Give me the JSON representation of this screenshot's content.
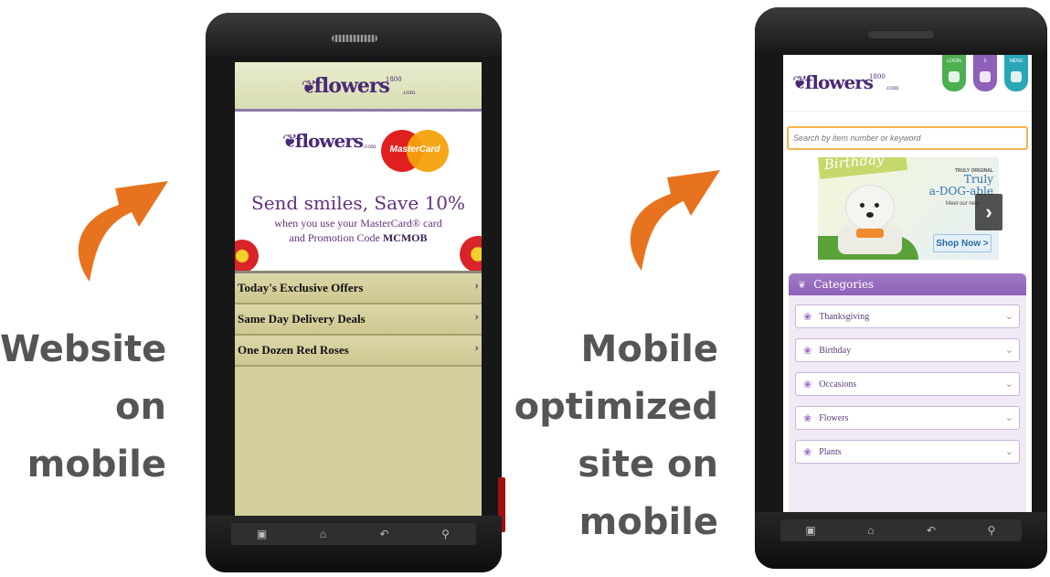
{
  "captions": {
    "left": [
      "Website",
      "on",
      "mobile"
    ],
    "right": [
      "Mobile",
      "optimized",
      "site on",
      "mobile"
    ]
  },
  "colors": {
    "arrow": "#e8731f",
    "caption": "#555555",
    "purple": "#8e60b8",
    "mastercard_red": "#e0201f",
    "mastercard_yellow": "#f5a20b"
  },
  "icons": {
    "arrows": "curved-up-right-arrow-icon",
    "phone_nav": [
      "menu-icon",
      "home-icon",
      "back-icon",
      "search-icon"
    ]
  },
  "left_phone": {
    "header_logo": {
      "number": "1800",
      "brand": "flowers",
      "suffix": ".com"
    },
    "banner": {
      "logo_brand": "flowers",
      "logo_suffix": ".com",
      "card_logo": "MasterCard",
      "headline": "Send smiles, Save 10%",
      "line1": "when you use your MasterCard® card",
      "line2_prefix": "and Promotion Code ",
      "promo_code": "MCMOB"
    },
    "menu": [
      {
        "label": "Today's Exclusive Offers",
        "chevron": "›"
      },
      {
        "label": "Same Day Delivery Deals",
        "chevron": "›"
      },
      {
        "label": "One Dozen Red Roses",
        "chevron": "›"
      }
    ]
  },
  "right_phone": {
    "logo": {
      "number": "1800",
      "brand": "flowers",
      "suffix": ".com"
    },
    "tabs": [
      {
        "label": "LOGIN",
        "color": "#4caf50"
      },
      {
        "label": "0",
        "color": "#8e60b8"
      },
      {
        "label": "MENU",
        "color": "#2aa7b6"
      }
    ],
    "search": {
      "placeholder": "Search by item number or keyword"
    },
    "banner": {
      "ribbon": "Birthday",
      "small": "TRULY ORIGINAL",
      "title_line1": "Truly",
      "title_line2": "a-DOG-able",
      "sub": "Meet our new",
      "cta": "Shop Now >",
      "next": "›"
    },
    "categories": {
      "title": "Categories",
      "items": [
        "Thanksgiving",
        "Birthday",
        "Occasions",
        "Flowers",
        "Plants"
      ]
    }
  }
}
